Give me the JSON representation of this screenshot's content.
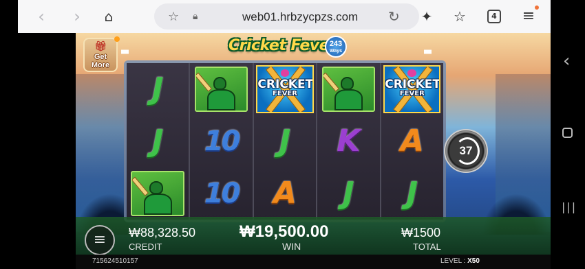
{
  "browser": {
    "url": "web01.hrbzycpzs.com",
    "tab_count": "4"
  },
  "game": {
    "title": "Cricket Fever",
    "ways_number": "243",
    "ways_label": "Ways",
    "get_more_line1": "Get",
    "get_more_line2": "More",
    "reels": [
      [
        {
          "type": "letter",
          "text": "J",
          "cls": "sym-J"
        },
        {
          "type": "letter",
          "text": "J",
          "cls": "sym-J"
        },
        {
          "type": "batsman"
        }
      ],
      [
        {
          "type": "batsman"
        },
        {
          "type": "letter",
          "text": "10",
          "cls": "sym-10"
        },
        {
          "type": "letter",
          "text": "10",
          "cls": "sym-10"
        }
      ],
      [
        {
          "type": "wild"
        },
        {
          "type": "letter",
          "text": "J",
          "cls": "sym-J"
        },
        {
          "type": "letter",
          "text": "A",
          "cls": "sym-A"
        }
      ],
      [
        {
          "type": "batsman"
        },
        {
          "type": "letter",
          "text": "K",
          "cls": "sym-K"
        },
        {
          "type": "letter",
          "text": "J",
          "cls": "sym-J"
        }
      ],
      [
        {
          "type": "wild"
        },
        {
          "type": "letter",
          "text": "A",
          "cls": "sym-A"
        },
        {
          "type": "letter",
          "text": "J",
          "cls": "sym-J"
        }
      ]
    ],
    "wild_line1": "CRICKET",
    "wild_line2": "FEVER",
    "spins_left": "37",
    "credit_value": "₩88,328.50",
    "credit_label": "CREDIT",
    "win_value": "₩19,500.00",
    "win_label": "WIN",
    "total_value": "₩1500",
    "total_label": "TOTAL",
    "game_id": "715624510157",
    "level_label": "LEVEL :",
    "level_value": "X50"
  },
  "colors": {
    "j": "#3fc24a",
    "ten": "#3e7fdc",
    "k": "#9b3fd0",
    "a": "#f28a1c"
  },
  "icons": [
    "back-icon",
    "forward-icon",
    "home-icon",
    "star-icon",
    "lock-icon",
    "reload-icon",
    "sparkle-icon",
    "bookmark-star-icon",
    "tabs-icon",
    "menu-icon",
    "system-back-icon",
    "system-home-icon",
    "system-recents-icon"
  ]
}
